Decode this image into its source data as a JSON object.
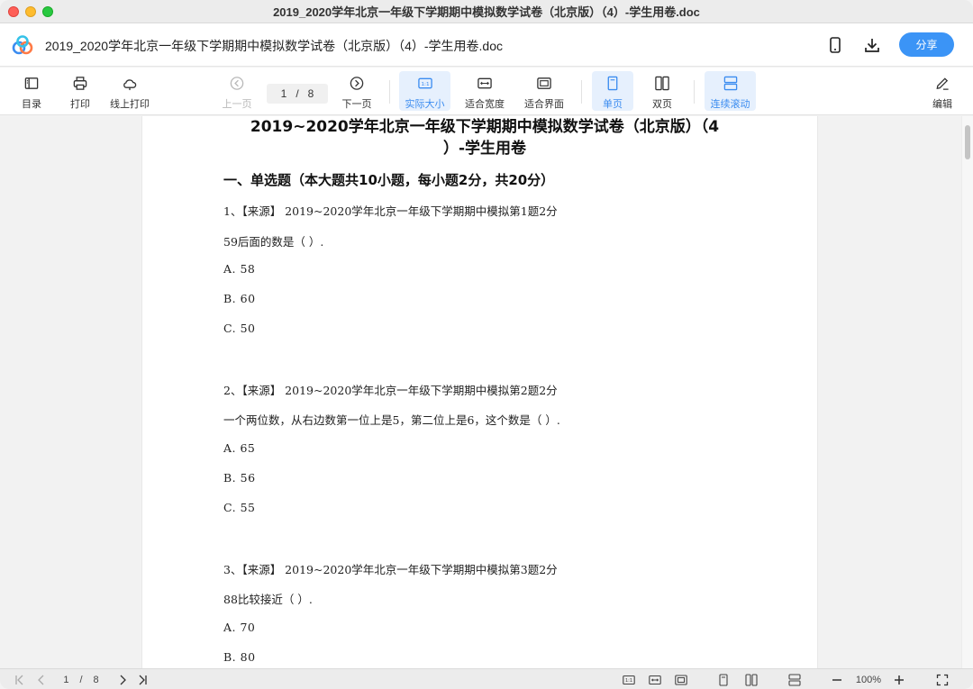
{
  "window": {
    "title": "2019_2020学年北京一年级下学期期中模拟数学试卷（北京版）（4）-学生用卷.doc"
  },
  "header": {
    "doc_title": "2019_2020学年北京一年级下学期期中模拟数学试卷（北京版）（4）-学生用卷.doc",
    "share_label": "分享",
    "icons": [
      "phone-icon",
      "download-icon"
    ]
  },
  "toolbar": {
    "toc": "目录",
    "print": "打印",
    "online_print": "线上打印",
    "prev": "上一页",
    "next": "下一页",
    "page_current": "1",
    "page_sep": "/",
    "page_total": "8",
    "actual_size": "实际大小",
    "fit_width": "适合宽度",
    "fit_page": "适合界面",
    "single": "单页",
    "double": "双页",
    "continuous": "连续滚动",
    "edit": "编辑"
  },
  "document": {
    "heading_line1": "2019~2020学年北京一年级下学期期中模拟数学试卷（北京版）（4",
    "heading_line2": "）-学生用卷",
    "section": "一、单选题（本大题共10小题，每小题2分，共20分）",
    "questions": [
      {
        "source": "1、【来源】 2019~2020学年北京一年级下学期期中模拟第1题2分",
        "stem": " 59后面的数是（    ）.",
        "options": [
          "A.  58",
          "B.  60",
          "C.  50"
        ]
      },
      {
        "source": "2、【来源】 2019~2020学年北京一年级下学期期中模拟第2题2分",
        "stem": "一个两位数，从右边数第一位上是5，第二位上是6，这个数是（    ）.",
        "options": [
          "A.  65",
          "B.  56",
          "C.  55"
        ]
      },
      {
        "source": "3、【来源】 2019~2020学年北京一年级下学期期中模拟第3题2分",
        "stem": " 88比较接近（    ）.",
        "options": [
          "A.  70",
          "B.  80"
        ]
      }
    ]
  },
  "statusbar": {
    "page_current": "1",
    "page_sep": "/",
    "page_total": "8",
    "zoom": "100%"
  },
  "colors": {
    "accent": "#3b94f6",
    "active_bg": "#e6f0fd"
  }
}
